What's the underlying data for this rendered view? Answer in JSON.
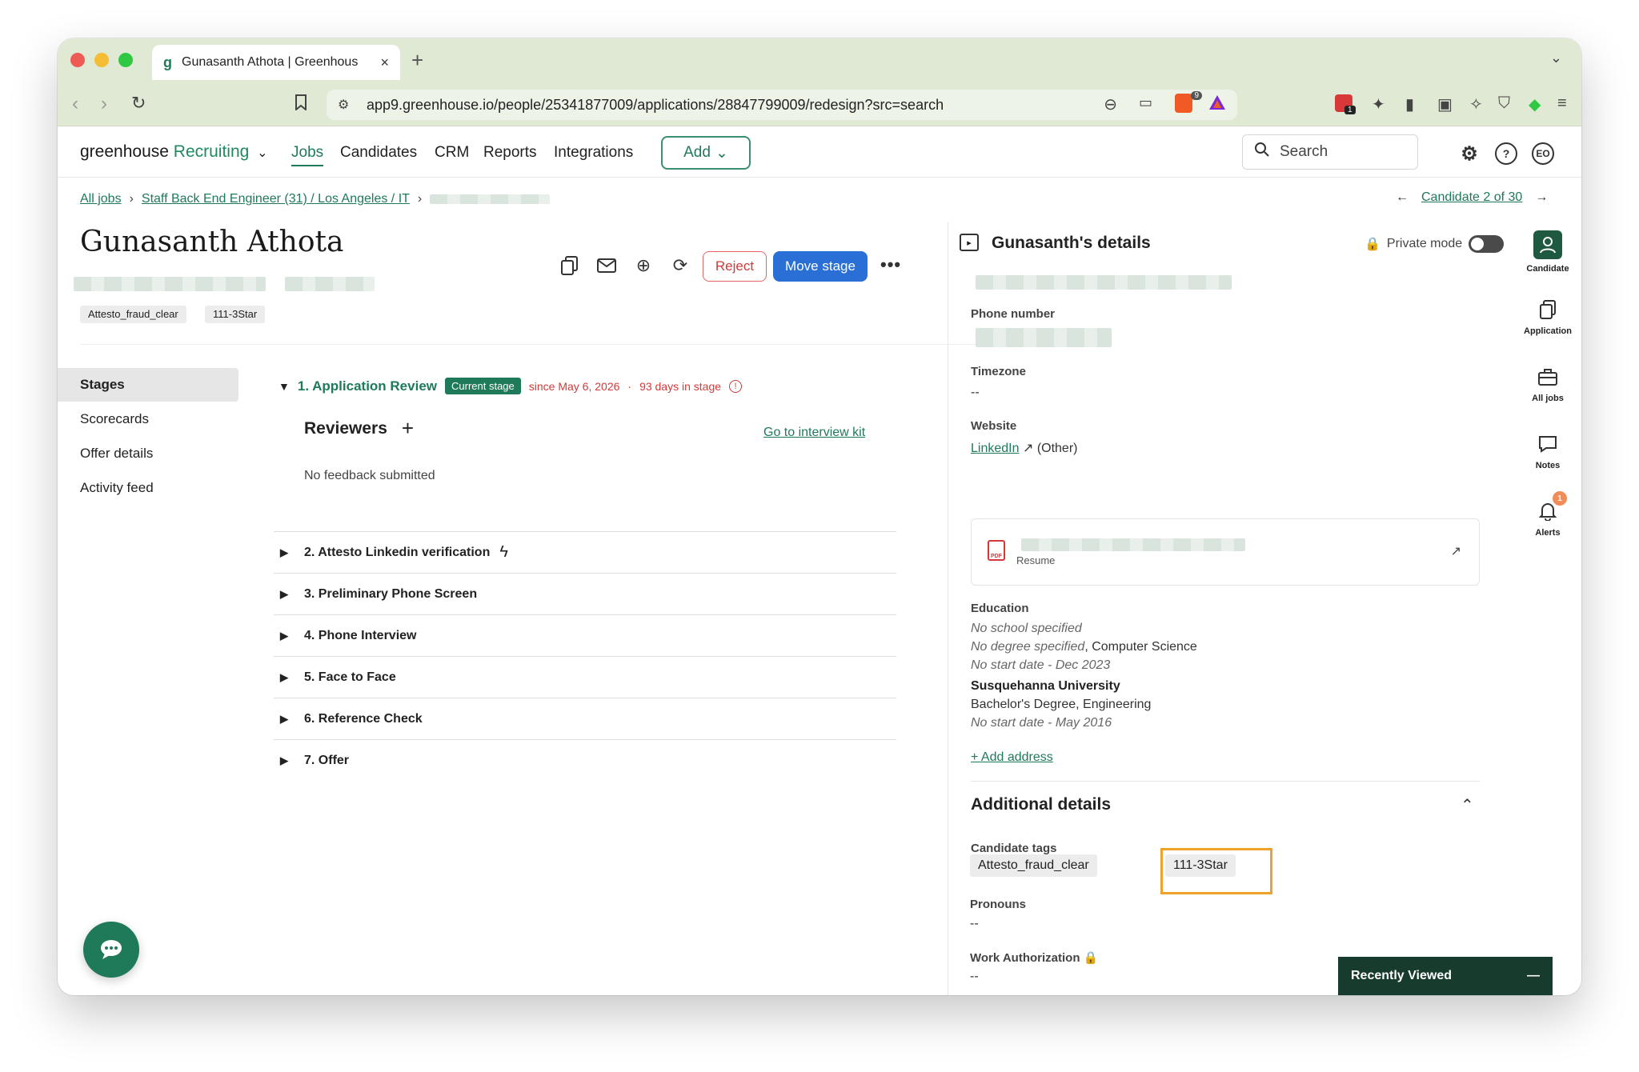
{
  "browser": {
    "tab_title": "Gunasanth Athota | Greenhous",
    "url": "app9.greenhouse.io/people/25341877009/applications/28847799009/redesign?src=search",
    "ext_badge_brave": "9",
    "ext_badge_other": "1"
  },
  "header": {
    "logo_main": "greenhouse",
    "logo_sub": "Recruiting",
    "nav": [
      "Jobs",
      "Candidates",
      "CRM",
      "Reports",
      "Integrations"
    ],
    "add_label": "Add",
    "search_placeholder": "Search",
    "user_initials": "EO"
  },
  "breadcrumb": {
    "all_jobs": "All jobs",
    "job": "Staff Back End Engineer (31) / Los Angeles / IT",
    "candidate_nav": "Candidate 2 of 30"
  },
  "candidate": {
    "name": "Gunasanth Athota",
    "tags": [
      "Attesto_fraud_clear",
      "111-3Star"
    ],
    "reject_label": "Reject",
    "move_label": "Move stage"
  },
  "sidenav": {
    "items": [
      "Stages",
      "Scorecards",
      "Offer details",
      "Activity feed"
    ]
  },
  "stages": {
    "current": {
      "label": "1. Application Review",
      "badge": "Current stage",
      "since": "since May 6, 2026",
      "days": "93 days in stage"
    },
    "reviewers_title": "Reviewers",
    "interview_kit": "Go to interview kit",
    "no_feedback": "No feedback submitted",
    "list": [
      "2. Attesto Linkedin verification",
      "3. Preliminary Phone Screen",
      "4. Phone Interview",
      "5. Face to Face",
      "6. Reference Check",
      "7. Offer"
    ]
  },
  "details": {
    "title": "Gunasanth's details",
    "private_mode": "Private mode",
    "phone_label": "Phone number",
    "timezone_label": "Timezone",
    "timezone_value": "--",
    "website_label": "Website",
    "website_link": "LinkedIn",
    "website_type": "(Other)",
    "resume_label": "Resume",
    "education_label": "Education",
    "edu": {
      "no_school": "No school specified",
      "no_degree": "No degree specified",
      "discipline1": ", Computer Science",
      "dates1": "No start date - Dec 2023",
      "school2": "Susquehanna University",
      "degree2": "Bachelor's Degree, Engineering",
      "dates2": "No start date - May 2016"
    },
    "add_address": "+ Add address",
    "additional_title": "Additional details",
    "candidate_tags_label": "Candidate tags",
    "candidate_tags": [
      "Attesto_fraud_clear",
      "111-3Star"
    ],
    "pronouns_label": "Pronouns",
    "pronouns_value": "--",
    "work_auth_label": "Work Authorization",
    "work_auth_value": "--"
  },
  "rail": {
    "items": [
      "Candidate",
      "Application",
      "All jobs",
      "Notes",
      "Alerts"
    ],
    "alerts_count": "1"
  },
  "recently_viewed": "Recently Viewed"
}
